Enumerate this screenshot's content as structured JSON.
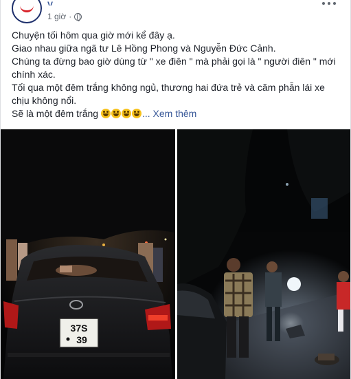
{
  "post": {
    "author": "V.. .. ..",
    "time": "1 giờ",
    "separator": "·",
    "privacy_icon": "globe-icon",
    "more_icon": "more-options-icon",
    "lines": [
      "Chuyện tối hôm qua giờ mới kể đây ạ.",
      "Giao nhau giữa ngã tư Lê Hồng Phong và Nguyễn Đức Cảnh.",
      "Chúng ta đừng bao giờ dùng từ \" xe điên \" mà phải gọi là \" người điên \" mới chính xác.",
      "Tối qua một đêm trắng không ngủ, thương hai đứa trẻ và căm phẫn lái xe chịu không nổi.",
      "Sẽ là một đêm trắng"
    ],
    "emoji_count": 4,
    "see_more": "... Xem thêm"
  },
  "photos": {
    "left": {
      "plate_line1": "37S",
      "plate_line2": "39"
    },
    "right": {}
  },
  "colors": {
    "link": "#385898",
    "text": "#1d2129",
    "meta": "#616770"
  }
}
